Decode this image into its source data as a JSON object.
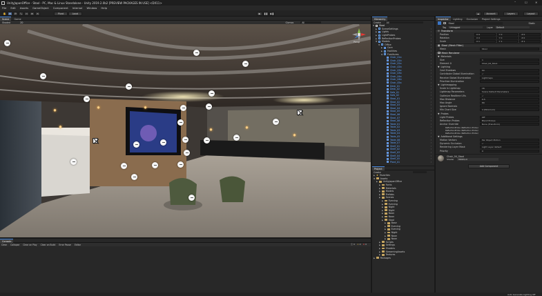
{
  "window": {
    "title": "UnityJapanOffice - Stool - PC, Mac & Linux Standalone - Unity 2019.2.0b2 [PREVIEW PACKAGES IN USE] <DX11>",
    "controls": [
      "–",
      "☐",
      "✕"
    ]
  },
  "menu": [
    "File",
    "Edit",
    "Assets",
    "GameObject",
    "Component",
    "Internal",
    "Window",
    "Help"
  ],
  "toolbar": {
    "pivot": "Pivot",
    "space": "Local",
    "account": "Account",
    "layers": "Layers",
    "layout": "Layout"
  },
  "scene_tabs": [
    "Scene",
    "Game"
  ],
  "scene_toolbar": {
    "shading": "Shaded",
    "mode": "2D",
    "gizmos": "Gizmos",
    "search": "All"
  },
  "gizmo": {
    "view": "Persp"
  },
  "hierarchy": {
    "tab": "Hierarchy",
    "create": "Create",
    "search": "All",
    "scene": "Stool",
    "items": [
      {
        "label": "SceneSettings",
        "depth": 1,
        "kind": "obj",
        "open": false
      },
      {
        "label": "Lights",
        "depth": 1,
        "kind": "obj",
        "open": false
      },
      {
        "label": "LightProbes",
        "depth": 1,
        "kind": "obj",
        "open": false
      },
      {
        "label": "ReflectionProbes",
        "depth": 1,
        "kind": "obj",
        "open": false
      },
      {
        "label": "Models",
        "depth": 1,
        "kind": "obj",
        "open": true
      },
      {
        "label": "Office",
        "depth": 2,
        "kind": "obj",
        "open": true
      },
      {
        "label": "Core",
        "depth": 3,
        "kind": "obj",
        "open": false
      },
      {
        "label": "Facilities",
        "depth": 3,
        "kind": "obj",
        "open": false
      },
      {
        "label": "Furnitures",
        "depth": 3,
        "kind": "obj",
        "open": true
      },
      {
        "label": "Chair_01a",
        "depth": 4,
        "kind": "prefab"
      },
      {
        "label": "Chair_01b",
        "depth": 4,
        "kind": "prefab"
      },
      {
        "label": "Chair_02a",
        "depth": 4,
        "kind": "prefab"
      },
      {
        "label": "Chair_02b",
        "depth": 4,
        "kind": "prefab"
      },
      {
        "label": "Chair_03a",
        "depth": 4,
        "kind": "prefab"
      },
      {
        "label": "Chair_03b",
        "depth": 4,
        "kind": "prefab"
      },
      {
        "label": "Chair_04a",
        "depth": 4,
        "kind": "prefab"
      },
      {
        "label": "Chair_04b",
        "depth": 4,
        "kind": "prefab"
      },
      {
        "label": "Chair_05a",
        "depth": 4,
        "kind": "prefab"
      },
      {
        "label": "Desk_01",
        "depth": 4,
        "kind": "prefab"
      },
      {
        "label": "Desk_02",
        "depth": 4,
        "kind": "prefab"
      },
      {
        "label": "Sofa_01",
        "depth": 4,
        "kind": "prefab"
      },
      {
        "label": "Sofa_02",
        "depth": 4,
        "kind": "prefab"
      },
      {
        "label": "Stool_01",
        "depth": 4,
        "kind": "prefab"
      },
      {
        "label": "Stool_02",
        "depth": 4,
        "kind": "prefab"
      },
      {
        "label": "Stool_03",
        "depth": 4,
        "kind": "prefab"
      },
      {
        "label": "Stool_04",
        "depth": 4,
        "kind": "prefab"
      },
      {
        "label": "Stool_05",
        "depth": 4,
        "kind": "prefab"
      },
      {
        "label": "Stool_06",
        "depth": 4,
        "kind": "prefab"
      },
      {
        "label": "Stool_07",
        "depth": 4,
        "kind": "prefab"
      },
      {
        "label": "Stool_08",
        "depth": 4,
        "kind": "prefab"
      },
      {
        "label": "Table_01",
        "depth": 4,
        "kind": "prefab"
      },
      {
        "label": "Table_02",
        "depth": 4,
        "kind": "prefab"
      },
      {
        "label": "Table_03",
        "depth": 4,
        "kind": "prefab"
      },
      {
        "label": "Table_04",
        "depth": 4,
        "kind": "prefab"
      },
      {
        "label": "Table_05",
        "depth": 4,
        "kind": "prefab"
      },
      {
        "label": "Table_06",
        "depth": 4,
        "kind": "prefab"
      },
      {
        "label": "Table_07",
        "depth": 4,
        "kind": "prefab"
      },
      {
        "label": "Shelf_01",
        "depth": 4,
        "kind": "prefab"
      },
      {
        "label": "Shelf_02",
        "depth": 4,
        "kind": "prefab"
      },
      {
        "label": "Shelf_03",
        "depth": 4,
        "kind": "prefab"
      },
      {
        "label": "Shelf_04",
        "depth": 4,
        "kind": "prefab"
      },
      {
        "label": "Shelf_05",
        "depth": 4,
        "kind": "prefab"
      },
      {
        "label": "Plant_01",
        "depth": 4,
        "kind": "prefab"
      }
    ]
  },
  "project": {
    "tab": "Project",
    "create": "Create",
    "favorites": "Favorites",
    "assets_label": "Assets",
    "packages_label": "Packages",
    "tree": [
      {
        "label": "UnityJapanOffice",
        "depth": 1
      },
      {
        "label": "Fonts",
        "depth": 2
      },
      {
        "label": "Materials",
        "depth": 2
      },
      {
        "label": "Models",
        "depth": 2
      },
      {
        "label": "Prefabs",
        "depth": 2
      },
      {
        "label": "Scenes",
        "depth": 2
      },
      {
        "label": "Evening",
        "depth": 3
      },
      {
        "label": "Evening",
        "depth": 3
      },
      {
        "label": "Night",
        "depth": 3
      },
      {
        "label": "Night",
        "depth": 3
      },
      {
        "label": "Noon",
        "depth": 3
      },
      {
        "label": "Noon",
        "depth": 3
      },
      {
        "label": "Stool",
        "depth": 3
      },
      {
        "label": "Base",
        "depth": 4
      },
      {
        "label": "Evening",
        "depth": 4
      },
      {
        "label": "Evening",
        "depth": 4
      },
      {
        "label": "Night",
        "depth": 4
      },
      {
        "label": "Noon",
        "depth": 4
      },
      {
        "label": "Noon",
        "depth": 4
      },
      {
        "label": "Scripts",
        "depth": 2
      },
      {
        "label": "Settings",
        "depth": 2
      },
      {
        "label": "Shaders",
        "depth": 2
      },
      {
        "label": "StreamingAssets",
        "depth": 2
      },
      {
        "label": "Textures",
        "depth": 2
      }
    ]
  },
  "inspector": {
    "tabs": [
      "Inspector",
      "Lighting",
      "Occlusion",
      "Project Settings"
    ],
    "object_name": "Stool",
    "static_label": "Static",
    "tag_label": "Tag",
    "tag_value": "Untagged",
    "layer_label": "Layer",
    "layer_value": "Default",
    "transform": {
      "title": "Transform",
      "rows": [
        {
          "label": "Position",
          "x": "X  0",
          "y": "Y  0",
          "z": "Z  0"
        },
        {
          "label": "Rotation",
          "x": "X  0",
          "y": "Y  0",
          "z": "Z  0"
        },
        {
          "label": "Scale",
          "x": "X  1",
          "y": "Y  1",
          "z": "Z  1"
        }
      ]
    },
    "mesh_filter": {
      "title": "Stool (Mesh Filter)",
      "mesh_label": "Mesh",
      "mesh_value": "Stool"
    },
    "mesh_renderer": {
      "title": "Mesh Renderer",
      "materials_section": "Materials",
      "size_label": "Size",
      "size_value": "1",
      "element_label": "Element 0",
      "element_value": "Chair_04_Stool",
      "lighting_section": "Lighting",
      "lighting_rows": [
        {
          "label": "Cast Shadows",
          "value": "On"
        },
        {
          "label": "Contribute Global Illumination",
          "value": "✓"
        },
        {
          "label": "Receive Global Illumination",
          "value": "Lightmaps"
        },
        {
          "label": "Prioritize Illumination",
          "value": ""
        }
      ],
      "lightmapping_section": "Lightmapping",
      "lightmapping_rows": [
        {
          "label": "Scale In Lightmap",
          "value": "16"
        },
        {
          "label": "Lightmap Parameters",
          "value": "Scene Default Parameters"
        },
        {
          "label": "Optimize Realtime UVs",
          "value": "✓"
        },
        {
          "label": "Max Distance",
          "value": "0.5"
        },
        {
          "label": "Max Angle",
          "value": "89"
        },
        {
          "label": "Ignore Normals",
          "value": ""
        },
        {
          "label": "Min Chart Size",
          "value": "4 (Minimum)"
        }
      ],
      "probes_section": "Probes",
      "probes_rows": [
        {
          "label": "Light Probes",
          "value": "Off"
        },
        {
          "label": "Reflection Probes",
          "value": "Blend Probes"
        },
        {
          "label": "Anchor Override",
          "value": "None (Transform)"
        }
      ],
      "probe_entries": [
        "ReflectionProbe (Reflection Probe)",
        "ReflectionProbe (Reflection Probe)",
        "ReflectionProbe (Reflection Probe)"
      ],
      "additional_section": "Additional Settings",
      "additional_rows": [
        {
          "label": "Motion Vectors",
          "value": "Per Object Motion"
        },
        {
          "label": "Dynamic Occlusion",
          "value": "✓"
        },
        {
          "label": "Rendering Layer Mask",
          "value": "Light Layer default"
        },
        {
          "label": "Priority",
          "value": "0"
        }
      ]
    },
    "material": {
      "name": "Chair_04_Stool",
      "shader_label": "Shader",
      "shader_value": "HDRP/Lit"
    },
    "add_component": "Add Component",
    "status": "Auto Generate Lighting Off"
  },
  "console": {
    "tab": "Console",
    "buttons": [
      "Clear",
      "Collapse",
      "Clear on Play",
      "Clear on Build",
      "Error Pause",
      "Editor"
    ],
    "counts": [
      "0",
      "0",
      "0"
    ]
  },
  "colors": {
    "accent": "#4a8ae0",
    "panel": "#282828",
    "prefab_text": "#5fa3ff"
  }
}
